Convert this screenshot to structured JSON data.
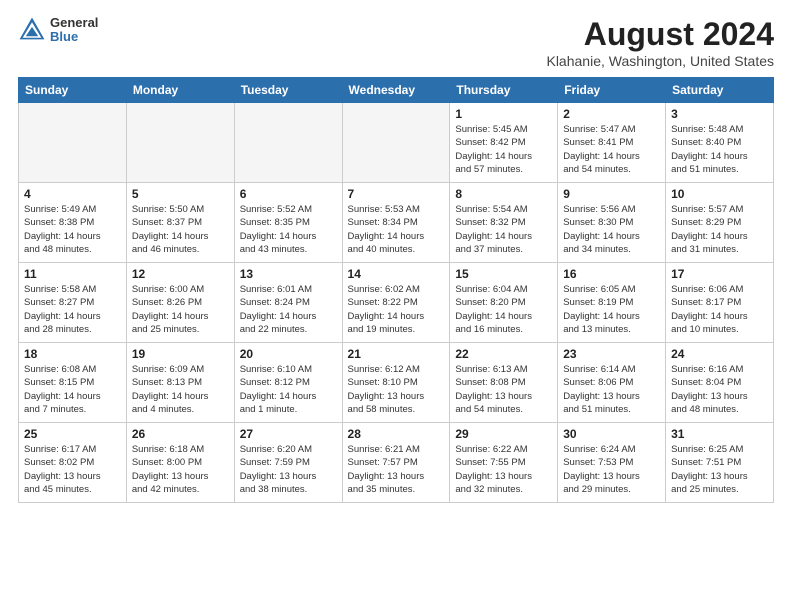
{
  "header": {
    "logo_general": "General",
    "logo_blue": "Blue",
    "main_title": "August 2024",
    "subtitle": "Klahanie, Washington, United States"
  },
  "weekdays": [
    "Sunday",
    "Monday",
    "Tuesday",
    "Wednesday",
    "Thursday",
    "Friday",
    "Saturday"
  ],
  "weeks": [
    [
      {
        "day": "",
        "info": ""
      },
      {
        "day": "",
        "info": ""
      },
      {
        "day": "",
        "info": ""
      },
      {
        "day": "",
        "info": ""
      },
      {
        "day": "1",
        "info": "Sunrise: 5:45 AM\nSunset: 8:42 PM\nDaylight: 14 hours\nand 57 minutes."
      },
      {
        "day": "2",
        "info": "Sunrise: 5:47 AM\nSunset: 8:41 PM\nDaylight: 14 hours\nand 54 minutes."
      },
      {
        "day": "3",
        "info": "Sunrise: 5:48 AM\nSunset: 8:40 PM\nDaylight: 14 hours\nand 51 minutes."
      }
    ],
    [
      {
        "day": "4",
        "info": "Sunrise: 5:49 AM\nSunset: 8:38 PM\nDaylight: 14 hours\nand 48 minutes."
      },
      {
        "day": "5",
        "info": "Sunrise: 5:50 AM\nSunset: 8:37 PM\nDaylight: 14 hours\nand 46 minutes."
      },
      {
        "day": "6",
        "info": "Sunrise: 5:52 AM\nSunset: 8:35 PM\nDaylight: 14 hours\nand 43 minutes."
      },
      {
        "day": "7",
        "info": "Sunrise: 5:53 AM\nSunset: 8:34 PM\nDaylight: 14 hours\nand 40 minutes."
      },
      {
        "day": "8",
        "info": "Sunrise: 5:54 AM\nSunset: 8:32 PM\nDaylight: 14 hours\nand 37 minutes."
      },
      {
        "day": "9",
        "info": "Sunrise: 5:56 AM\nSunset: 8:30 PM\nDaylight: 14 hours\nand 34 minutes."
      },
      {
        "day": "10",
        "info": "Sunrise: 5:57 AM\nSunset: 8:29 PM\nDaylight: 14 hours\nand 31 minutes."
      }
    ],
    [
      {
        "day": "11",
        "info": "Sunrise: 5:58 AM\nSunset: 8:27 PM\nDaylight: 14 hours\nand 28 minutes."
      },
      {
        "day": "12",
        "info": "Sunrise: 6:00 AM\nSunset: 8:26 PM\nDaylight: 14 hours\nand 25 minutes."
      },
      {
        "day": "13",
        "info": "Sunrise: 6:01 AM\nSunset: 8:24 PM\nDaylight: 14 hours\nand 22 minutes."
      },
      {
        "day": "14",
        "info": "Sunrise: 6:02 AM\nSunset: 8:22 PM\nDaylight: 14 hours\nand 19 minutes."
      },
      {
        "day": "15",
        "info": "Sunrise: 6:04 AM\nSunset: 8:20 PM\nDaylight: 14 hours\nand 16 minutes."
      },
      {
        "day": "16",
        "info": "Sunrise: 6:05 AM\nSunset: 8:19 PM\nDaylight: 14 hours\nand 13 minutes."
      },
      {
        "day": "17",
        "info": "Sunrise: 6:06 AM\nSunset: 8:17 PM\nDaylight: 14 hours\nand 10 minutes."
      }
    ],
    [
      {
        "day": "18",
        "info": "Sunrise: 6:08 AM\nSunset: 8:15 PM\nDaylight: 14 hours\nand 7 minutes."
      },
      {
        "day": "19",
        "info": "Sunrise: 6:09 AM\nSunset: 8:13 PM\nDaylight: 14 hours\nand 4 minutes."
      },
      {
        "day": "20",
        "info": "Sunrise: 6:10 AM\nSunset: 8:12 PM\nDaylight: 14 hours\nand 1 minute."
      },
      {
        "day": "21",
        "info": "Sunrise: 6:12 AM\nSunset: 8:10 PM\nDaylight: 13 hours\nand 58 minutes."
      },
      {
        "day": "22",
        "info": "Sunrise: 6:13 AM\nSunset: 8:08 PM\nDaylight: 13 hours\nand 54 minutes."
      },
      {
        "day": "23",
        "info": "Sunrise: 6:14 AM\nSunset: 8:06 PM\nDaylight: 13 hours\nand 51 minutes."
      },
      {
        "day": "24",
        "info": "Sunrise: 6:16 AM\nSunset: 8:04 PM\nDaylight: 13 hours\nand 48 minutes."
      }
    ],
    [
      {
        "day": "25",
        "info": "Sunrise: 6:17 AM\nSunset: 8:02 PM\nDaylight: 13 hours\nand 45 minutes."
      },
      {
        "day": "26",
        "info": "Sunrise: 6:18 AM\nSunset: 8:00 PM\nDaylight: 13 hours\nand 42 minutes."
      },
      {
        "day": "27",
        "info": "Sunrise: 6:20 AM\nSunset: 7:59 PM\nDaylight: 13 hours\nand 38 minutes."
      },
      {
        "day": "28",
        "info": "Sunrise: 6:21 AM\nSunset: 7:57 PM\nDaylight: 13 hours\nand 35 minutes."
      },
      {
        "day": "29",
        "info": "Sunrise: 6:22 AM\nSunset: 7:55 PM\nDaylight: 13 hours\nand 32 minutes."
      },
      {
        "day": "30",
        "info": "Sunrise: 6:24 AM\nSunset: 7:53 PM\nDaylight: 13 hours\nand 29 minutes."
      },
      {
        "day": "31",
        "info": "Sunrise: 6:25 AM\nSunset: 7:51 PM\nDaylight: 13 hours\nand 25 minutes."
      }
    ]
  ]
}
